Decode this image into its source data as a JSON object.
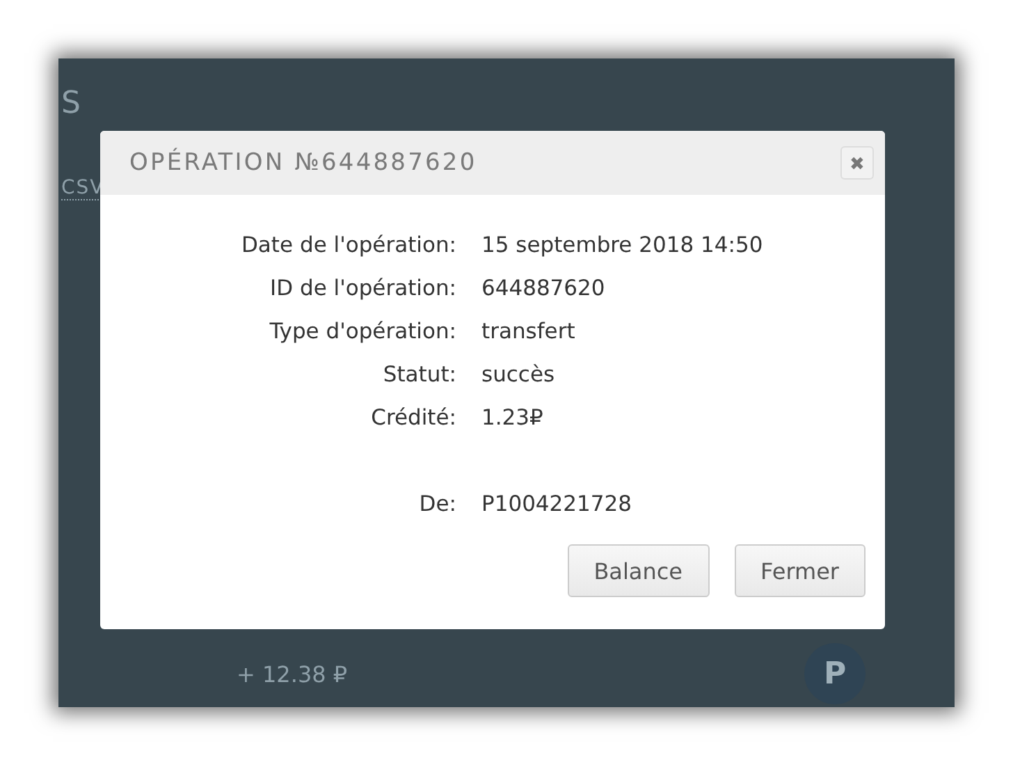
{
  "background": {
    "heading": "S",
    "link": "CSV",
    "amount": "+ 12.38 ₽",
    "badge": "P"
  },
  "dialog": {
    "title": "OPÉRATION №644887620",
    "close": "✖",
    "fields": [
      {
        "label": "Date de l'opération:",
        "value": "15 septembre 2018 14:50"
      },
      {
        "label": "ID de l'opération:",
        "value": "644887620"
      },
      {
        "label": "Type d'opération:",
        "value": "transfert"
      },
      {
        "label": "Statut:",
        "value": "succès"
      },
      {
        "label": "Crédité:",
        "value": "1.23₽"
      },
      {
        "label": "De:",
        "value": "P1004221728",
        "gap": true
      }
    ],
    "buttons": [
      "Balance",
      "Fermer"
    ]
  }
}
